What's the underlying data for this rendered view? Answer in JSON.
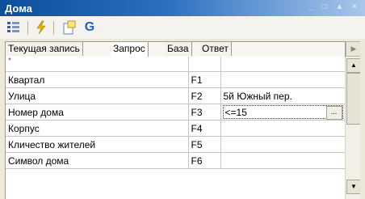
{
  "window": {
    "title": "Дома",
    "controls": "_ □ ▲ ×"
  },
  "toolbar": {
    "buttons": [
      {
        "icon": "field-list-icon"
      },
      {
        "icon": "lightning-icon"
      },
      {
        "icon": "new-document-icon"
      },
      {
        "icon": "g-letter-icon",
        "glyph": "G"
      }
    ]
  },
  "tabs": [
    {
      "label": "Текущая запись"
    },
    {
      "label": "Запрос"
    },
    {
      "label": "База"
    },
    {
      "label": "Ответ"
    }
  ],
  "active_tab": "Запрос",
  "grid": {
    "header_marker": "*",
    "rows": [
      {
        "name": "Квартал",
        "field": "F1",
        "value": ""
      },
      {
        "name": "Улица",
        "field": "F2",
        "value": "5й Южный пер."
      },
      {
        "name": "Номер дома",
        "field": "F3",
        "value": "<=15"
      },
      {
        "name": "Корпус",
        "field": "F4",
        "value": ""
      },
      {
        "name": "Кличество жителей",
        "field": "F5",
        "value": ""
      },
      {
        "name": "Символ дома",
        "field": "F6",
        "value": ""
      }
    ],
    "editing_ellipsis": "..."
  },
  "colors": {
    "title_start": "#0c4f9a",
    "title_end": "#a9c6ea",
    "accent_blue": "#1f5fbf",
    "lightning": "#e0b400"
  }
}
